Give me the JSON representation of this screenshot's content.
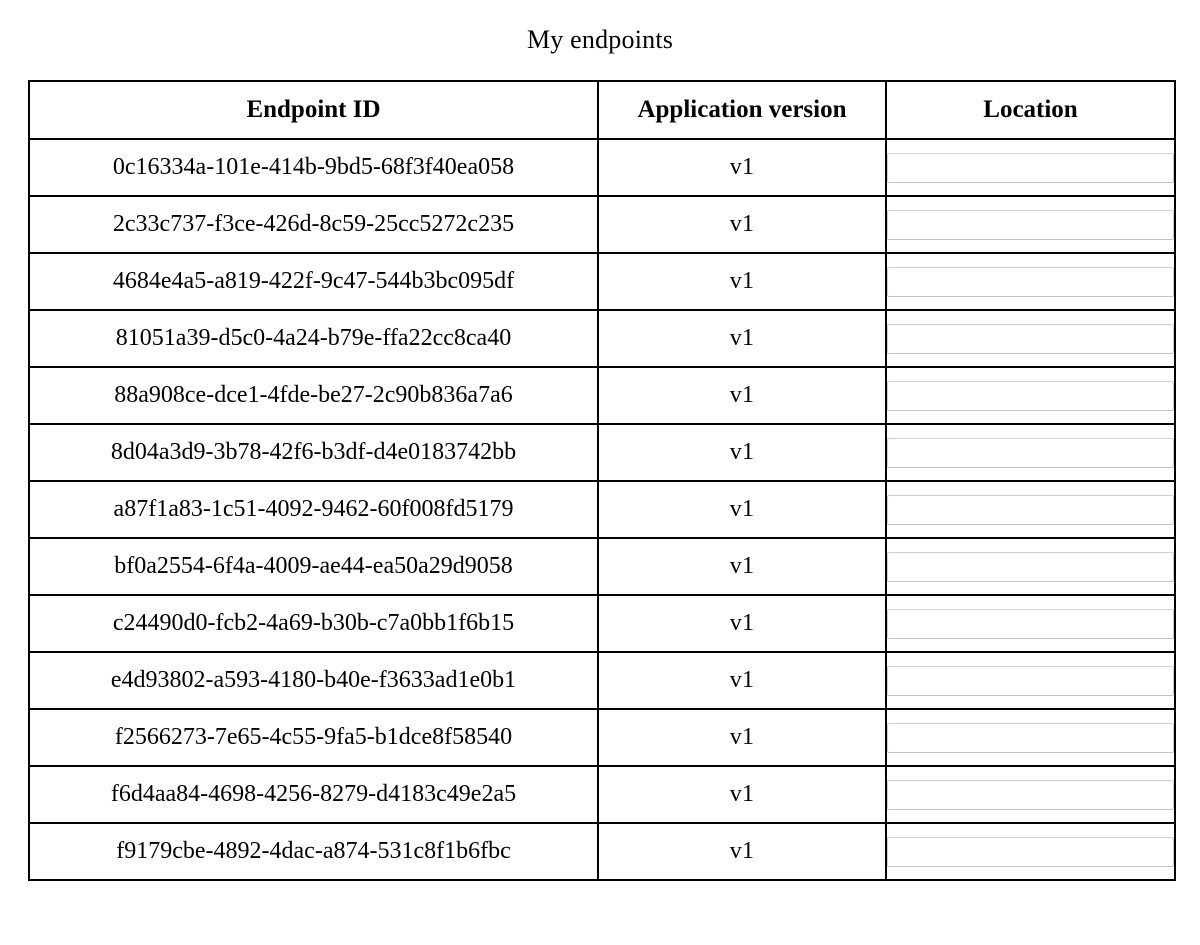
{
  "page": {
    "title": "My endpoints"
  },
  "table": {
    "columns": [
      {
        "key": "endpoint_id",
        "label": "Endpoint ID"
      },
      {
        "key": "application_version",
        "label": "Application version"
      },
      {
        "key": "location",
        "label": "Location"
      }
    ],
    "rows": [
      {
        "endpoint_id": "0c16334a-101e-414b-9bd5-68f3f40ea058",
        "application_version": "v1",
        "location_value": "",
        "location_placeholder": ""
      },
      {
        "endpoint_id": "2c33c737-f3ce-426d-8c59-25cc5272c235",
        "application_version": "v1",
        "location_value": "",
        "location_placeholder": ""
      },
      {
        "endpoint_id": "4684e4a5-a819-422f-9c47-544b3bc095df",
        "application_version": "v1",
        "location_value": "",
        "location_placeholder": ""
      },
      {
        "endpoint_id": "81051a39-d5c0-4a24-b79e-ffa22cc8ca40",
        "application_version": "v1",
        "location_value": "",
        "location_placeholder": ""
      },
      {
        "endpoint_id": "88a908ce-dce1-4fde-be27-2c90b836a7a6",
        "application_version": "v1",
        "location_value": "",
        "location_placeholder": ""
      },
      {
        "endpoint_id": "8d04a3d9-3b78-42f6-b3df-d4e0183742bb",
        "application_version": "v1",
        "location_value": "",
        "location_placeholder": ""
      },
      {
        "endpoint_id": "a87f1a83-1c51-4092-9462-60f008fd5179",
        "application_version": "v1",
        "location_value": "",
        "location_placeholder": ""
      },
      {
        "endpoint_id": "bf0a2554-6f4a-4009-ae44-ea50a29d9058",
        "application_version": "v1",
        "location_value": "",
        "location_placeholder": ""
      },
      {
        "endpoint_id": "c24490d0-fcb2-4a69-b30b-c7a0bb1f6b15",
        "application_version": "v1",
        "location_value": "",
        "location_placeholder": ""
      },
      {
        "endpoint_id": "e4d93802-a593-4180-b40e-f3633ad1e0b1",
        "application_version": "v1",
        "location_value": "",
        "location_placeholder": ""
      },
      {
        "endpoint_id": "f2566273-7e65-4c55-9fa5-b1dce8f58540",
        "application_version": "v1",
        "location_value": "",
        "location_placeholder": ""
      },
      {
        "endpoint_id": "f6d4aa84-4698-4256-8279-d4183c49e2a5",
        "application_version": "v1",
        "location_value": "",
        "location_placeholder": ""
      },
      {
        "endpoint_id": "f9179cbe-4892-4dac-a874-531c8f1b6fbc",
        "application_version": "v1",
        "location_value": "",
        "location_placeholder": ""
      }
    ]
  },
  "colors": {
    "page_background": "#ffffff",
    "text": "#000000",
    "table_border": "#000000",
    "input_border": "#c7c7c7"
  }
}
